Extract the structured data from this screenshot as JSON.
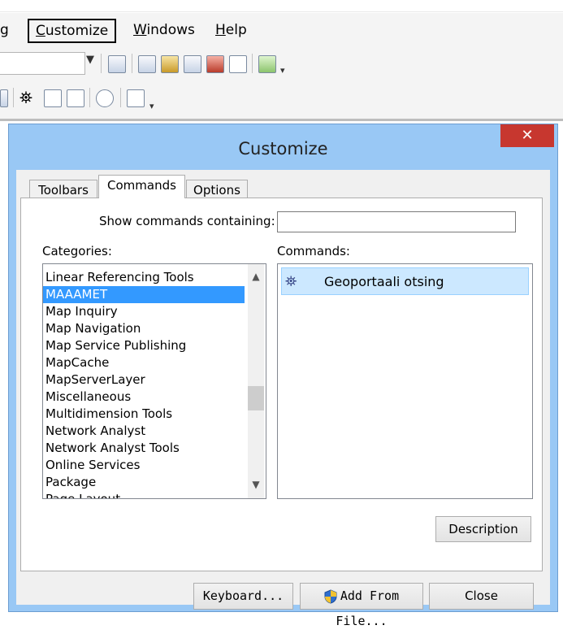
{
  "menubar": {
    "partial_item": "g",
    "items": [
      {
        "label": "Customize",
        "accel": "C",
        "rest": "ustomize"
      },
      {
        "label": "Windows",
        "accel": "W",
        "rest": "indows"
      },
      {
        "label": "Help",
        "accel": "H",
        "rest": "elp"
      }
    ]
  },
  "dialog": {
    "title": "Customize",
    "close_glyph": "✕",
    "tabs": [
      "Toolbars",
      "Commands",
      "Options"
    ],
    "active_tab": "Commands",
    "search_label": "Show commands containing:",
    "search_value": "",
    "categories_label": "Categories:",
    "commands_label": "Commands:",
    "categories": [
      "Linear Referencing Tools",
      "MAAAMET",
      "Map Inquiry",
      "Map Navigation",
      "Map Service Publishing",
      "MapCache",
      "MapServerLayer",
      "Miscellaneous",
      "Multidimension Tools",
      "Network Analyst",
      "Network Analyst Tools",
      "Online Services",
      "Package",
      "Page Layout"
    ],
    "selected_category": "MAAAMET",
    "commands": [
      {
        "label": "Geoportaali otsing",
        "icon": "binoculars-icon"
      }
    ],
    "description_button": "Description",
    "keyboard_button": "Keyboard...",
    "add_from_file_button": "Add From File...",
    "close_button": "Close"
  },
  "colors": {
    "title_bar": "#99c8f5",
    "close_red": "#c7372f",
    "selection": "#3399ff",
    "command_highlight": "#cce8ff"
  }
}
